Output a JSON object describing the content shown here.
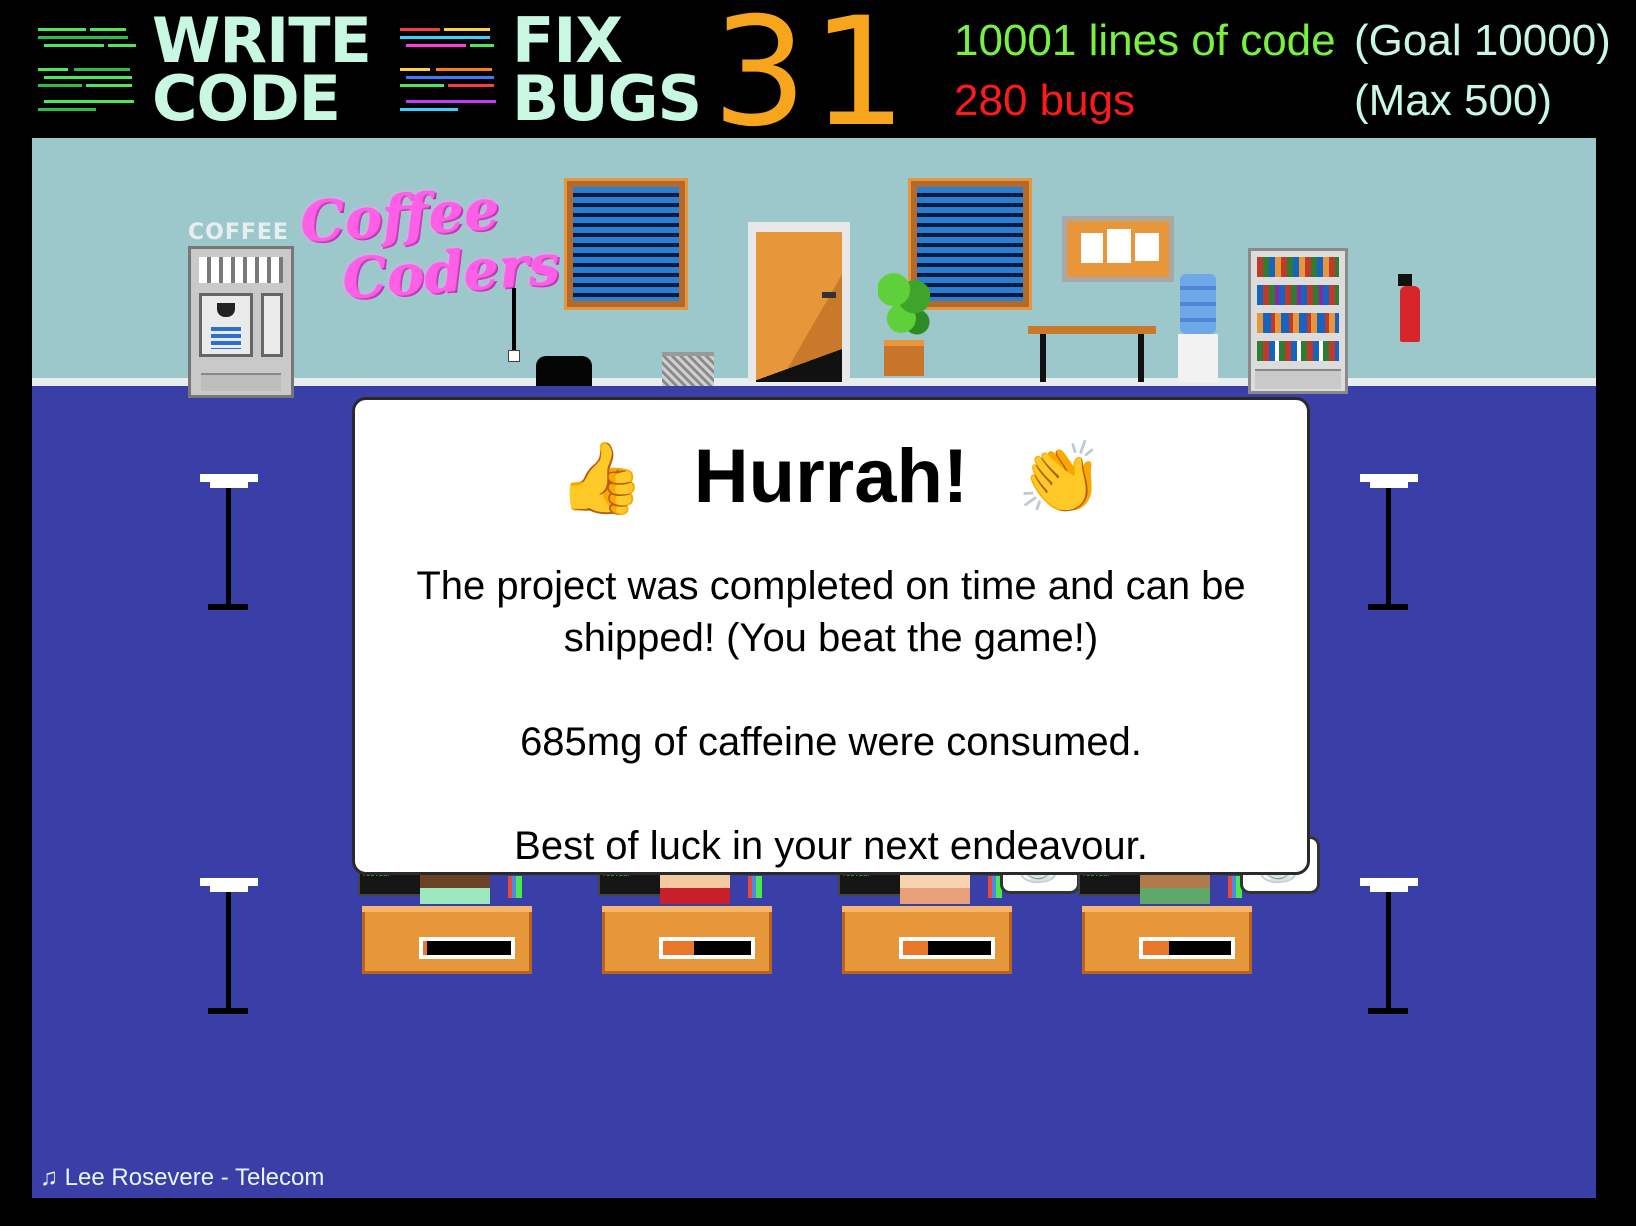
{
  "hud": {
    "write_code": "WRITE\nCODE",
    "fix_bugs": "FIX\nBUGS",
    "day": "31",
    "lines_of_code": "10001 lines of code",
    "goal": "(Goal 10000)",
    "bugs": "280 bugs",
    "max": "(Max 500)",
    "colors": {
      "lines": "#79f23d",
      "bugs": "#ff1a1a",
      "goal": "#c8f7e2",
      "day": "#f7a51c"
    }
  },
  "office": {
    "coffee_machine_label": "COFFEE",
    "neon_sign": [
      "Coffee",
      "Coders"
    ]
  },
  "dialog": {
    "title": "Hurrah!",
    "icon_left": "👍",
    "icon_right": "👏",
    "message_1": "The project was completed on time and can be shipped! (You beat the game!)",
    "message_2": "685mg of caffeine were consumed.",
    "message_3": "Best of luck in your next endeavour."
  },
  "workers": [
    {
      "name": "worker-1",
      "progress": 0.05,
      "coffee": false
    },
    {
      "name": "worker-2",
      "progress": 0.35,
      "coffee": false
    },
    {
      "name": "worker-3",
      "progress": 0.28,
      "coffee": true
    },
    {
      "name": "worker-4",
      "progress": 0.3,
      "coffee": true
    }
  ],
  "footer": {
    "music_icon": "music-note-icon",
    "track": "Lee Rosevere - Telecom"
  }
}
